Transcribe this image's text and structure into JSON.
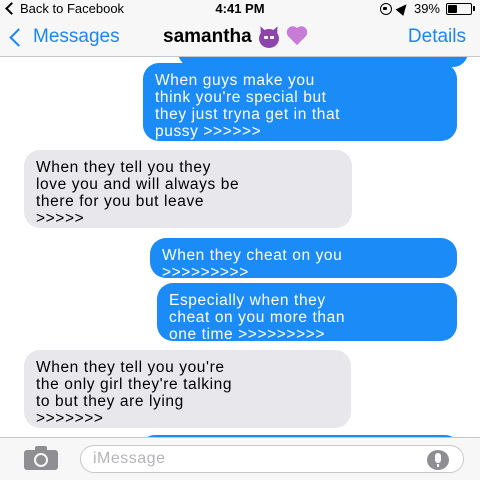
{
  "status_bar": {
    "back_label": "Back to Facebook",
    "time": "4:41 PM",
    "battery": "39%",
    "battery_level": 0.39
  },
  "nav": {
    "back_label": "Messages",
    "title": "samantha",
    "title_icons": [
      "devil-icon",
      "purple-heart-icon"
    ],
    "details_label": "Details"
  },
  "messages": [
    {
      "side": "sent",
      "text": "When guys make you\nthink you're special but\nthey just tryna get in that\npussy >>>>>>"
    },
    {
      "side": "received",
      "text": "When they tell you they\nlove you and will always be\nthere for you but leave\n>>>>>"
    },
    {
      "side": "sent",
      "text": "When they cheat on you\n>>>>>>>>>"
    },
    {
      "side": "sent",
      "text": "Especially when they\ncheat on you more than\none time >>>>>>>>>"
    },
    {
      "side": "received",
      "text": "When they tell you you're\nthe only girl they're talking\nto but they are lying\n>>>>>>>"
    }
  ],
  "composer": {
    "placeholder": "iMessage"
  },
  "colors": {
    "accent": "#1a86f7",
    "sent_bubble": "#1b8cf7",
    "received_bubble": "#e7e7ec"
  }
}
